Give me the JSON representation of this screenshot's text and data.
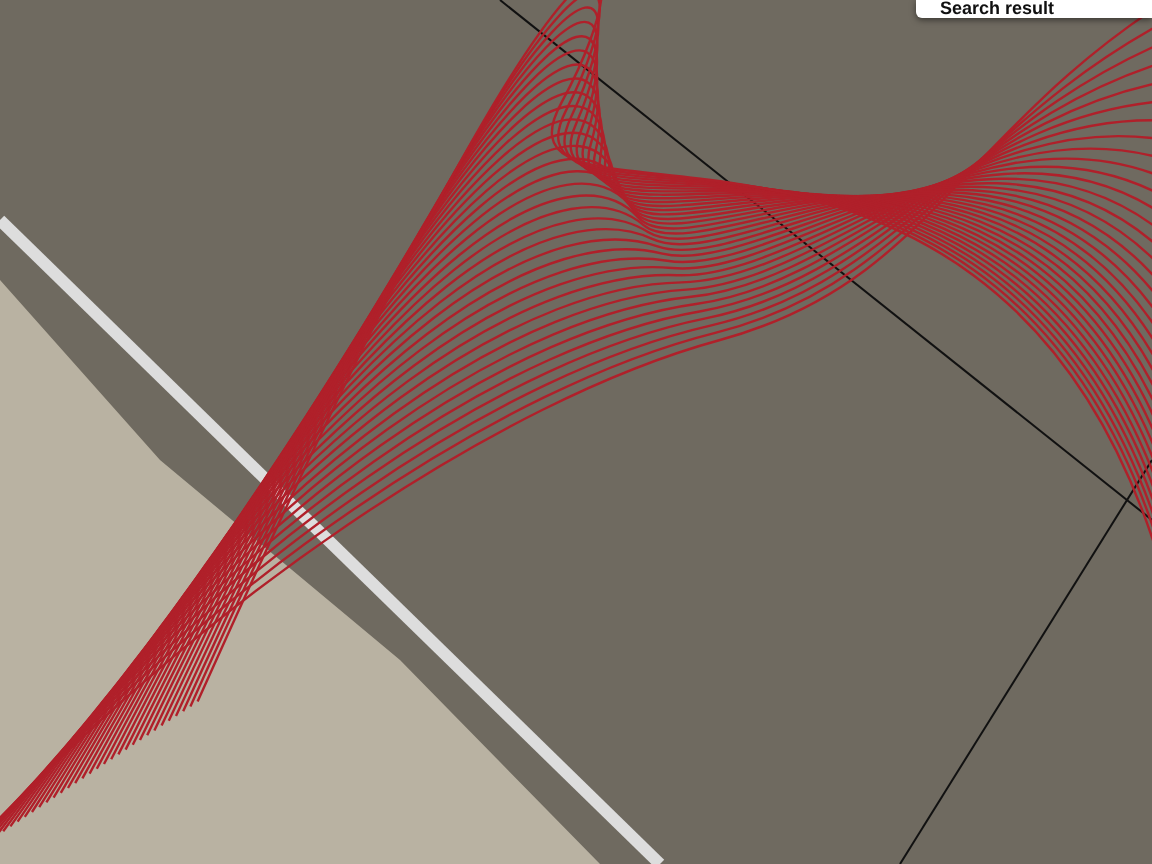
{
  "search_result": {
    "label": "Search result"
  }
}
